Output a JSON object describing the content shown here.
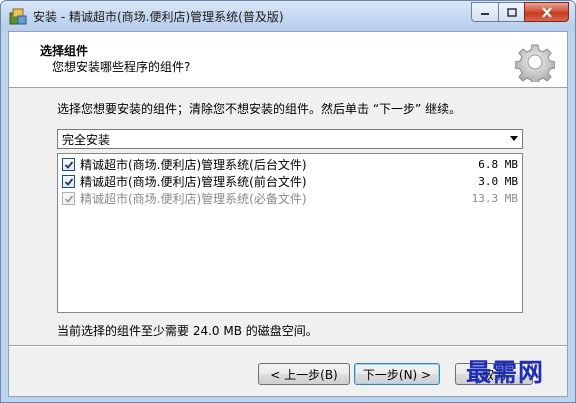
{
  "window": {
    "title": "安装 - 精诚超市(商场.便利店)管理系统(普及版)"
  },
  "header": {
    "title": "选择组件",
    "subtitle": "您想安装哪些程序的组件?"
  },
  "instruction": "选择您想要安装的组件；清除您不想安装的组件。然后单击 “下一步” 继续。",
  "install_type": {
    "selected": "完全安装"
  },
  "components": [
    {
      "label": "精诚超市(商场.便利店)管理系统(后台文件)",
      "size": "6.8 MB",
      "checked": true,
      "disabled": false
    },
    {
      "label": "精诚超市(商场.便利店)管理系统(前台文件)",
      "size": "3.0 MB",
      "checked": true,
      "disabled": false
    },
    {
      "label": "精诚超市(商场.便利店)管理系统(必备文件)",
      "size": "13.3 MB",
      "checked": true,
      "disabled": true
    }
  ],
  "space_required": "当前选择的组件至少需要 24.0 MB 的磁盘空间。",
  "buttons": {
    "back": "< 上一步(B)",
    "next": "下一步(N) >",
    "cancel": "取消"
  },
  "watermark": "最需网",
  "colors": {
    "titlebar": "#c2d6ef",
    "close": "#c23a1f",
    "watermark": "#1f2fb5"
  }
}
